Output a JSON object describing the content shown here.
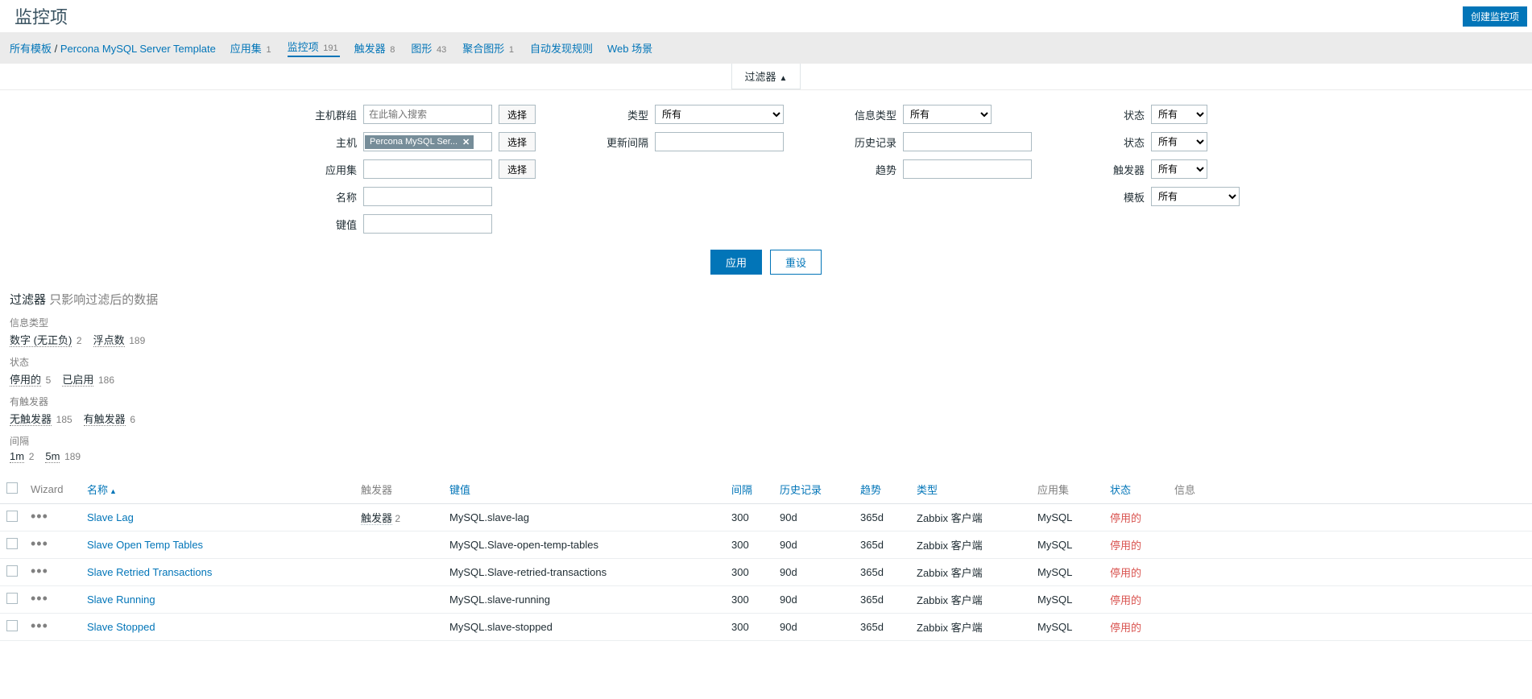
{
  "page": {
    "title": "监控项",
    "create_button": "创建监控项"
  },
  "breadcrumb": {
    "all_templates": "所有模板",
    "template_name": "Percona MySQL Server Template"
  },
  "subnav": {
    "app": {
      "label": "应用集",
      "count": "1"
    },
    "items": {
      "label": "监控项",
      "count": "191"
    },
    "triggers": {
      "label": "触发器",
      "count": "8"
    },
    "graphs": {
      "label": "图形",
      "count": "43"
    },
    "screens": {
      "label": "聚合图形",
      "count": "1"
    },
    "discovery": {
      "label": "自动发现规则"
    },
    "web": {
      "label": "Web 场景"
    }
  },
  "filter_tab": {
    "label": "过滤器",
    "arrow": "▲"
  },
  "filters": {
    "host_group": {
      "label": "主机群组",
      "placeholder": "在此输入搜索",
      "select": "选择"
    },
    "host": {
      "label": "主机",
      "chip": "Percona MySQL Ser...",
      "select": "选择"
    },
    "app_set": {
      "label": "应用集",
      "select": "选择"
    },
    "name": {
      "label": "名称"
    },
    "key": {
      "label": "键值"
    },
    "type": {
      "label": "类型",
      "value": "所有"
    },
    "update_interval": {
      "label": "更新间隔"
    },
    "info_type": {
      "label": "信息类型",
      "value": "所有"
    },
    "history": {
      "label": "历史记录"
    },
    "trends": {
      "label": "趋势"
    },
    "status": {
      "label": "状态",
      "value": "所有"
    },
    "state": {
      "label": "状态",
      "value": "所有"
    },
    "trigger": {
      "label": "触发器",
      "value": "所有"
    },
    "template": {
      "label": "模板",
      "value": "所有"
    },
    "apply": "应用",
    "reset": "重设"
  },
  "subfilter": {
    "title": "过滤器",
    "hint": "只影响过滤后的数据",
    "groups": [
      {
        "label": "信息类型",
        "items": [
          {
            "val": "数字 (无正负)",
            "cnt": "2"
          },
          {
            "val": "浮点数",
            "cnt": "189"
          }
        ]
      },
      {
        "label": "状态",
        "items": [
          {
            "val": "停用的",
            "cnt": "5"
          },
          {
            "val": "已启用",
            "cnt": "186"
          }
        ]
      },
      {
        "label": "有触发器",
        "items": [
          {
            "val": "无触发器",
            "cnt": "185"
          },
          {
            "val": "有触发器",
            "cnt": "6"
          }
        ]
      },
      {
        "label": "间隔",
        "items": [
          {
            "val": "1m",
            "cnt": "2"
          },
          {
            "val": "5m",
            "cnt": "189"
          }
        ]
      }
    ]
  },
  "table": {
    "headers": {
      "wizard": "Wizard",
      "name": "名称",
      "triggers": "触发器",
      "key": "键值",
      "interval": "间隔",
      "history": "历史记录",
      "trends": "趋势",
      "type": "类型",
      "app": "应用集",
      "status": "状态",
      "info": "信息"
    },
    "rows": [
      {
        "name": "Slave Lag",
        "trigger_label": "触发器",
        "trigger_count": "2",
        "key": "MySQL.slave-lag",
        "interval": "300",
        "history": "90d",
        "trends": "365d",
        "type": "Zabbix 客户端",
        "app": "MySQL",
        "status": "停用的"
      },
      {
        "name": "Slave Open Temp Tables",
        "trigger_label": "",
        "trigger_count": "",
        "key": "MySQL.Slave-open-temp-tables",
        "interval": "300",
        "history": "90d",
        "trends": "365d",
        "type": "Zabbix 客户端",
        "app": "MySQL",
        "status": "停用的"
      },
      {
        "name": "Slave Retried Transactions",
        "trigger_label": "",
        "trigger_count": "",
        "key": "MySQL.Slave-retried-transactions",
        "interval": "300",
        "history": "90d",
        "trends": "365d",
        "type": "Zabbix 客户端",
        "app": "MySQL",
        "status": "停用的"
      },
      {
        "name": "Slave Running",
        "trigger_label": "",
        "trigger_count": "",
        "key": "MySQL.slave-running",
        "interval": "300",
        "history": "90d",
        "trends": "365d",
        "type": "Zabbix 客户端",
        "app": "MySQL",
        "status": "停用的"
      },
      {
        "name": "Slave Stopped",
        "trigger_label": "",
        "trigger_count": "",
        "key": "MySQL.slave-stopped",
        "interval": "300",
        "history": "90d",
        "trends": "365d",
        "type": "Zabbix 客户端",
        "app": "MySQL",
        "status": "停用的"
      }
    ]
  }
}
